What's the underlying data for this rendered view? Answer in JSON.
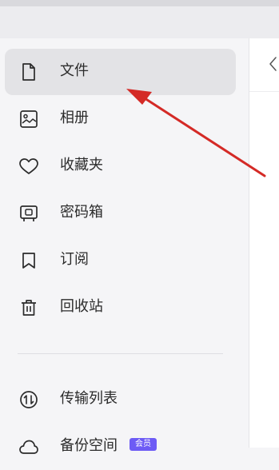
{
  "sidebar": {
    "items": [
      {
        "label": "文件",
        "icon": "file-icon",
        "active": true
      },
      {
        "label": "相册",
        "icon": "photo-album-icon"
      },
      {
        "label": "收藏夹",
        "icon": "heart-icon"
      },
      {
        "label": "密码箱",
        "icon": "safe-box-icon"
      },
      {
        "label": "订阅",
        "icon": "bookmark-icon"
      },
      {
        "label": "回收站",
        "icon": "trash-icon"
      },
      {
        "label": "传输列表",
        "icon": "transfer-icon"
      },
      {
        "label": "备份空间",
        "icon": "cloud-backup-icon",
        "badge": "会员"
      }
    ]
  },
  "colors": {
    "annotation_arrow": "#d42a26",
    "badge": "#6d5bf5",
    "active_item": "#e3e3e6"
  }
}
